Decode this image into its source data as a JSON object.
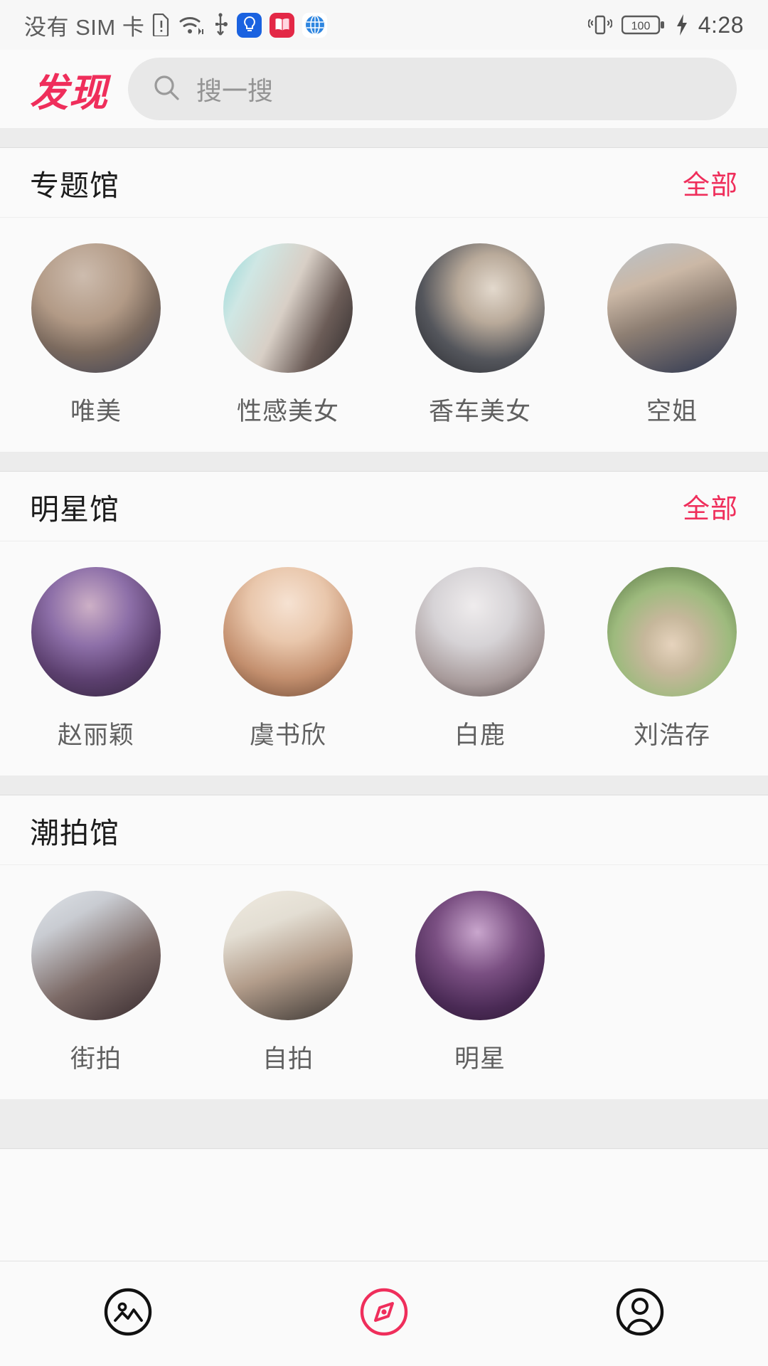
{
  "status_bar": {
    "carrier": "没有 SIM 卡",
    "icons": [
      "sim-alert-icon",
      "wifi-icon",
      "usb-icon",
      "flashlight-app-icon",
      "book-app-icon",
      "browser-app-icon"
    ],
    "vibrate_icon": "vibrate-icon",
    "battery_level": "100",
    "charging_icon": "charging-bolt-icon",
    "time": "4:28"
  },
  "header": {
    "brand": "发现",
    "search": {
      "placeholder": "搜一搜",
      "icon": "search-icon"
    }
  },
  "sections": [
    {
      "title": "专题馆",
      "all_label": "全部",
      "items": [
        {
          "label": "唯美",
          "colors": [
            "#cdbcae",
            "#7b6a5e",
            "#3a3f55"
          ]
        },
        {
          "label": "性感美女",
          "colors": [
            "#8fd6d6",
            "#d8cfc6",
            "#2e2b2c"
          ]
        },
        {
          "label": "香车美女",
          "colors": [
            "#54565c",
            "#b9aa9a",
            "#24252a"
          ]
        },
        {
          "label": "空姐",
          "colors": [
            "#b7c2cc",
            "#8e7f73",
            "#2b3550"
          ]
        }
      ]
    },
    {
      "title": "明星馆",
      "all_label": "全部",
      "items": [
        {
          "label": "赵丽颖",
          "colors": [
            "#8d6fa8",
            "#5b3f6e",
            "#2f2238"
          ]
        },
        {
          "label": "虞书欣",
          "colors": [
            "#e9c7ac",
            "#c38f6e",
            "#6a4632"
          ]
        },
        {
          "label": "白鹿",
          "colors": [
            "#d6d3d6",
            "#a79a9a",
            "#4a3f40"
          ]
        },
        {
          "label": "刘浩存",
          "colors": [
            "#9dba7d",
            "#6e8a56",
            "#d8c6ae"
          ]
        }
      ]
    },
    {
      "title": "潮拍馆",
      "all_label": "",
      "items": [
        {
          "label": "街拍",
          "colors": [
            "#c9ccd2",
            "#7c6a66",
            "#35282c"
          ]
        },
        {
          "label": "自拍",
          "colors": [
            "#e3ded3",
            "#b39d8b",
            "#3a3532"
          ]
        },
        {
          "label": "明星",
          "colors": [
            "#7a4f82",
            "#4a2a55",
            "#2a1730"
          ]
        }
      ]
    }
  ],
  "bottom_nav": {
    "items": [
      {
        "name": "gallery-nav-icon",
        "active": false
      },
      {
        "name": "discover-nav-icon",
        "active": true
      },
      {
        "name": "profile-nav-icon",
        "active": false
      }
    ],
    "active_color": "#ef2e5b",
    "inactive_color": "#111111"
  }
}
